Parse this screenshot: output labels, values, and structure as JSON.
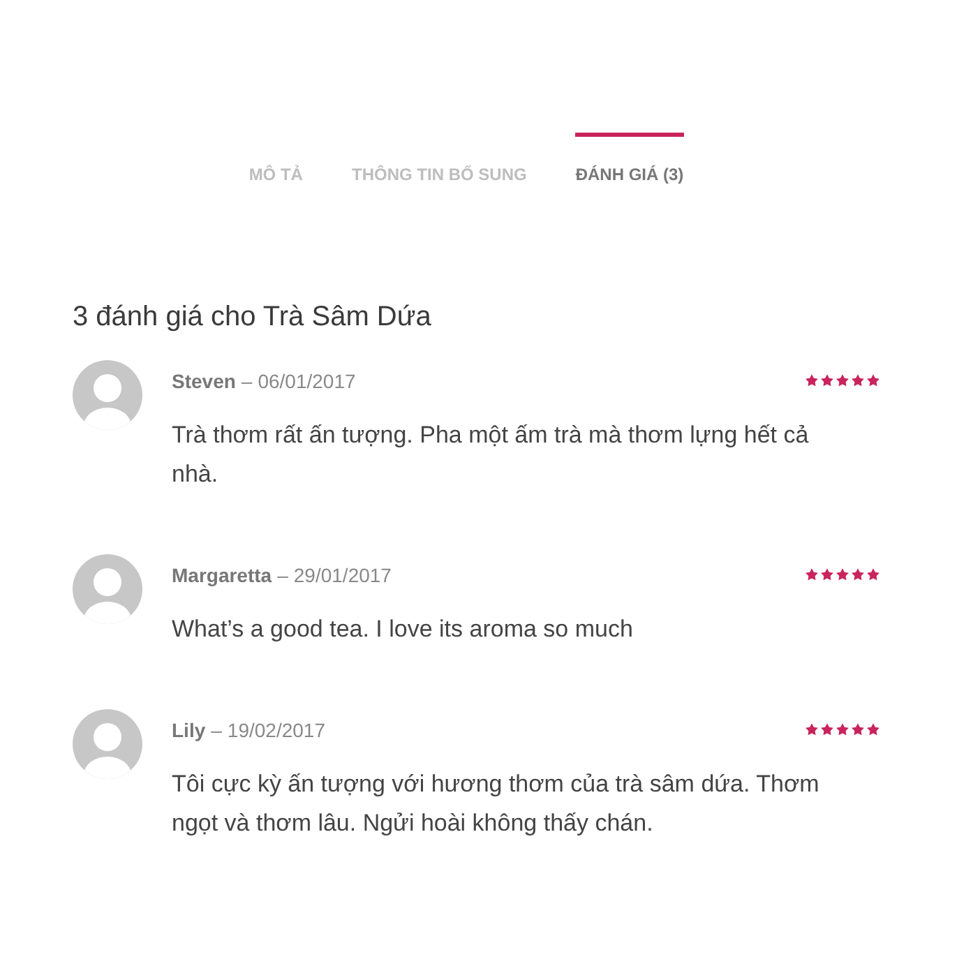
{
  "tabs": [
    {
      "label": "MÔ TẢ",
      "selected": false
    },
    {
      "label": "THÔNG TIN BỔ SUNG",
      "selected": false
    },
    {
      "label": "ĐÁNH GIÁ (3)",
      "selected": true
    }
  ],
  "reviews_heading": "3 đánh giá cho Trà Sâm Dứa",
  "reviews": [
    {
      "author": "Steven",
      "separator": "–",
      "date": "06/01/2017",
      "stars": 5,
      "text": "Trà thơm rất ấn tượng. Pha một ấm trà mà thơm lựng hết cả nhà."
    },
    {
      "author": "Margaretta",
      "separator": "–",
      "date": "29/01/2017",
      "stars": 5,
      "text": "What’s a good tea. I love its aroma so much"
    },
    {
      "author": "Lily",
      "separator": "–",
      "date": "19/02/2017",
      "stars": 5,
      "text": "Tôi cực kỳ ấn tượng với hương thơm của trà sâm dứa. Thơm ngọt và thơm lâu. Ngửi hoài không thấy chán."
    }
  ]
}
